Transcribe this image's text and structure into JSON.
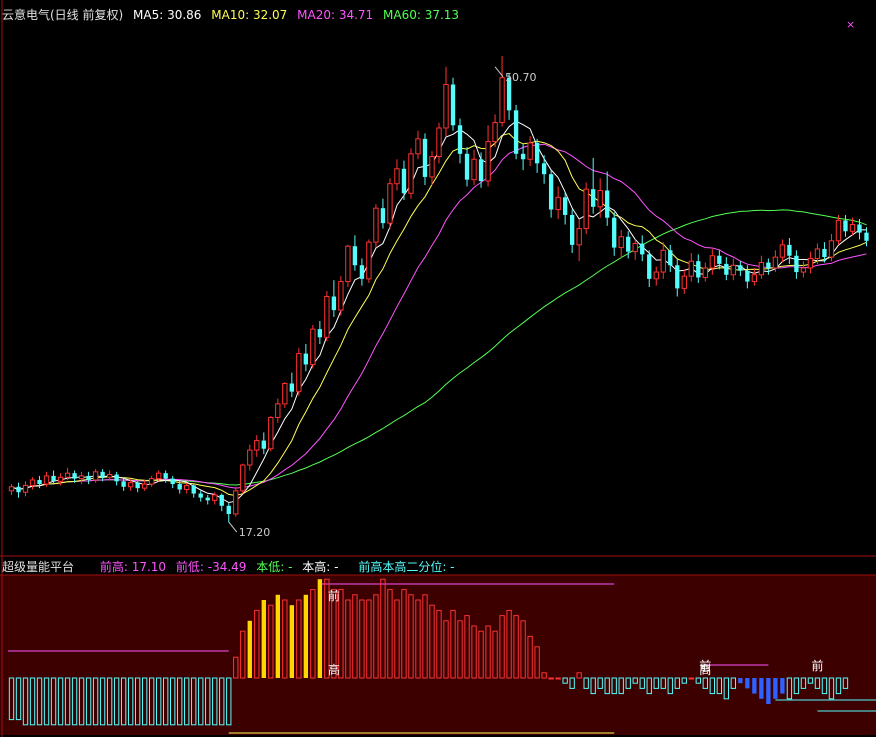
{
  "header": {
    "title": "云意电气(日线 前复权)",
    "ma5": "MA5: 30.86",
    "ma10": "MA10: 32.07",
    "ma20": "MA20: 34.71",
    "ma60": "MA60: 37.13",
    "close_mark": "×"
  },
  "colors": {
    "up": "#ff3232",
    "down": "#54fcfc",
    "ma5": "#ffffff",
    "ma10": "#ffff54",
    "ma20": "#ff54ff",
    "ma60": "#54ff54",
    "indicator_bg": "#3c0000",
    "yellow": "#ffd700",
    "blue": "#3060ff"
  },
  "indicator_header": {
    "name": "超级量能平台",
    "prev_high": "前高: 17.10",
    "prev_low": "前低: -34.49",
    "this_low": "本低: -",
    "this_high": "本高: -",
    "quantile": "前高本高二分位: -"
  },
  "chart_data": {
    "type": "candlestick",
    "price_range": [
      15,
      54
    ],
    "annotations": [
      {
        "text": "50.70",
        "index": 69,
        "value": 50.7
      },
      {
        "text": "17.20",
        "index": 31,
        "value": 17.2
      }
    ],
    "candles": [
      [
        19.5,
        19.8,
        20.0,
        19.2
      ],
      [
        19.8,
        19.4,
        20.1,
        19.0
      ],
      [
        19.4,
        19.9,
        20.2,
        19.1
      ],
      [
        19.9,
        20.3,
        20.5,
        19.6
      ],
      [
        20.3,
        20.0,
        20.6,
        19.7
      ],
      [
        20.0,
        20.6,
        20.9,
        19.8
      ],
      [
        20.6,
        20.2,
        21.0,
        20.0
      ],
      [
        20.2,
        20.5,
        20.8,
        19.9
      ],
      [
        20.5,
        20.8,
        21.2,
        20.3
      ],
      [
        20.8,
        20.4,
        21.0,
        20.1
      ],
      [
        20.4,
        20.6,
        20.9,
        20.0
      ],
      [
        20.6,
        20.3,
        20.9,
        20.0
      ],
      [
        20.3,
        20.9,
        21.1,
        20.1
      ],
      [
        20.9,
        20.5,
        21.1,
        20.2
      ],
      [
        20.5,
        20.7,
        21.0,
        20.3
      ],
      [
        20.7,
        20.2,
        20.9,
        19.9
      ],
      [
        20.2,
        19.8,
        20.4,
        19.5
      ],
      [
        19.8,
        20.1,
        20.4,
        19.5
      ],
      [
        20.1,
        19.7,
        20.2,
        19.4
      ],
      [
        19.7,
        20.0,
        20.3,
        19.5
      ],
      [
        20.0,
        20.4,
        20.6,
        19.8
      ],
      [
        20.4,
        20.8,
        21.0,
        20.2
      ],
      [
        20.8,
        20.4,
        21.0,
        20.1
      ],
      [
        20.4,
        20.0,
        20.6,
        19.7
      ],
      [
        20.0,
        19.6,
        20.2,
        19.3
      ],
      [
        19.6,
        19.9,
        20.1,
        19.3
      ],
      [
        19.9,
        19.3,
        20.0,
        19.0
      ],
      [
        19.3,
        19.0,
        19.5,
        18.7
      ],
      [
        19.0,
        18.8,
        19.2,
        18.5
      ],
      [
        18.8,
        19.2,
        19.4,
        18.5
      ],
      [
        19.2,
        18.4,
        19.3,
        18.0
      ],
      [
        18.4,
        17.8,
        18.6,
        17.2
      ],
      [
        17.8,
        19.5,
        19.8,
        17.6
      ],
      [
        19.5,
        21.4,
        21.5,
        19.3
      ],
      [
        21.4,
        22.5,
        22.9,
        21.0
      ],
      [
        22.5,
        23.2,
        23.6,
        22.0
      ],
      [
        23.2,
        22.6,
        23.8,
        22.2
      ],
      [
        22.6,
        24.9,
        25.0,
        22.4
      ],
      [
        24.9,
        25.9,
        26.3,
        24.5
      ],
      [
        25.9,
        27.4,
        27.5,
        25.6
      ],
      [
        27.4,
        26.8,
        28.2,
        26.4
      ],
      [
        26.8,
        29.6,
        30.0,
        26.5
      ],
      [
        29.6,
        28.8,
        30.3,
        28.3
      ],
      [
        28.8,
        31.4,
        31.7,
        28.5
      ],
      [
        31.4,
        30.8,
        32.0,
        30.3
      ],
      [
        30.8,
        33.8,
        34.2,
        30.5
      ],
      [
        33.8,
        32.8,
        35.0,
        32.3
      ],
      [
        32.8,
        34.9,
        35.3,
        32.4
      ],
      [
        34.9,
        37.5,
        37.6,
        34.5
      ],
      [
        37.5,
        36.1,
        38.3,
        35.7
      ],
      [
        36.1,
        35.1,
        36.6,
        34.6
      ],
      [
        35.1,
        37.8,
        38.0,
        34.8
      ],
      [
        37.8,
        40.3,
        40.6,
        37.4
      ],
      [
        40.3,
        39.2,
        41.0,
        38.8
      ],
      [
        39.2,
        42.1,
        42.5,
        38.8
      ],
      [
        42.1,
        43.2,
        43.9,
        41.6
      ],
      [
        43.2,
        41.4,
        43.8,
        40.9
      ],
      [
        41.4,
        44.3,
        44.7,
        41.0
      ],
      [
        44.3,
        45.4,
        46.0,
        43.9
      ],
      [
        45.4,
        42.6,
        45.8,
        42.0
      ],
      [
        42.6,
        44.1,
        44.5,
        42.0
      ],
      [
        44.1,
        46.2,
        46.6,
        43.6
      ],
      [
        46.2,
        49.4,
        50.7,
        45.6
      ],
      [
        49.4,
        46.4,
        49.9,
        46.0
      ],
      [
        46.4,
        44.3,
        46.9,
        43.6
      ],
      [
        44.3,
        42.4,
        44.8,
        41.9
      ],
      [
        42.4,
        43.9,
        44.6,
        42.0
      ],
      [
        43.9,
        42.3,
        44.4,
        41.8
      ],
      [
        42.3,
        45.2,
        46.4,
        41.9
      ],
      [
        45.2,
        46.6,
        47.2,
        44.8
      ],
      [
        46.6,
        49.9,
        51.5,
        46.3
      ],
      [
        49.9,
        47.5,
        50.2,
        46.8
      ],
      [
        47.5,
        44.3,
        47.9,
        43.9
      ],
      [
        44.3,
        43.9,
        45.0,
        43.1
      ],
      [
        43.9,
        45.1,
        45.6,
        43.4
      ],
      [
        45.1,
        43.6,
        45.4,
        42.9
      ],
      [
        43.6,
        42.8,
        44.2,
        42.1
      ],
      [
        42.8,
        40.2,
        43.1,
        39.6
      ],
      [
        40.2,
        41.1,
        41.9,
        39.5
      ],
      [
        41.1,
        39.8,
        41.5,
        39.1
      ],
      [
        39.8,
        37.6,
        40.2,
        37.0
      ],
      [
        37.6,
        38.8,
        39.5,
        36.4
      ],
      [
        38.8,
        41.7,
        42.2,
        38.4
      ],
      [
        41.7,
        40.4,
        44.0,
        39.9
      ],
      [
        40.4,
        41.6,
        42.5,
        39.6
      ],
      [
        41.6,
        39.6,
        43.0,
        39.0
      ],
      [
        39.6,
        37.4,
        40.0,
        36.8
      ],
      [
        37.4,
        38.2,
        38.7,
        36.6
      ],
      [
        38.2,
        37.1,
        38.6,
        36.6
      ],
      [
        37.1,
        37.7,
        38.0,
        36.5
      ],
      [
        37.7,
        36.9,
        38.3,
        36.4
      ],
      [
        36.9,
        35.1,
        37.2,
        34.5
      ],
      [
        35.1,
        35.6,
        36.0,
        34.6
      ],
      [
        35.6,
        37.2,
        37.8,
        35.1
      ],
      [
        37.2,
        36.1,
        37.6,
        35.6
      ],
      [
        36.1,
        34.4,
        36.6,
        33.8
      ],
      [
        34.4,
        35.3,
        35.8,
        34.0
      ],
      [
        35.3,
        36.4,
        37.0,
        34.9
      ],
      [
        36.4,
        35.2,
        36.9,
        34.8
      ],
      [
        35.2,
        35.9,
        36.3,
        34.9
      ],
      [
        35.9,
        36.8,
        37.3,
        35.4
      ],
      [
        36.8,
        36.2,
        37.2,
        35.8
      ],
      [
        36.2,
        35.4,
        36.7,
        35.0
      ],
      [
        35.4,
        36.1,
        36.6,
        35.0
      ],
      [
        36.1,
        35.7,
        36.4,
        35.3
      ],
      [
        35.7,
        34.9,
        36.1,
        34.4
      ],
      [
        34.9,
        35.4,
        35.9,
        34.6
      ],
      [
        35.4,
        36.3,
        36.8,
        35.1
      ],
      [
        36.3,
        35.9,
        36.6,
        35.4
      ],
      [
        35.9,
        36.7,
        37.2,
        35.6
      ],
      [
        36.7,
        37.6,
        38.0,
        36.3
      ],
      [
        37.6,
        36.8,
        38.1,
        36.2
      ],
      [
        36.8,
        35.6,
        37.2,
        35.1
      ],
      [
        35.6,
        35.9,
        36.4,
        35.2
      ],
      [
        35.9,
        36.6,
        37.1,
        35.5
      ],
      [
        36.6,
        37.3,
        37.7,
        36.2
      ],
      [
        37.3,
        36.7,
        37.8,
        36.3
      ],
      [
        36.7,
        37.9,
        38.4,
        36.4
      ],
      [
        37.9,
        39.4,
        39.8,
        37.6
      ],
      [
        39.4,
        38.6,
        39.8,
        38.2
      ],
      [
        38.6,
        39.1,
        39.6,
        38.3
      ],
      [
        39.1,
        38.5,
        39.5,
        38.0
      ],
      [
        38.5,
        37.9,
        38.9,
        37.5
      ]
    ],
    "ma5_line": "",
    "ma10_line": "",
    "ma20_line": "",
    "ma60_line": "",
    "indicator": {
      "baseline": 0,
      "bars": [
        -16,
        -16,
        -18,
        -18,
        -18,
        -18,
        -18,
        -18,
        -18,
        -18,
        -18,
        -18,
        -18,
        -18,
        -18,
        -18,
        -18,
        -18,
        -18,
        -18,
        -18,
        -18,
        -18,
        -18,
        -18,
        -18,
        -18,
        -18,
        -18,
        -18,
        -18,
        -18,
        8,
        18,
        22,
        26,
        30,
        28,
        32,
        30,
        28,
        30,
        32,
        34,
        38,
        38,
        34,
        34,
        30,
        32,
        30,
        30,
        32,
        38,
        34,
        30,
        34,
        32,
        30,
        32,
        28,
        26,
        22,
        26,
        22,
        24,
        20,
        18,
        20,
        18,
        24,
        26,
        24,
        22,
        16,
        12,
        2,
        0,
        0,
        -2,
        -4,
        2,
        -4,
        -6,
        -4,
        -6,
        -6,
        -6,
        -4,
        -2,
        -4,
        -6,
        -4,
        -4,
        -6,
        -4,
        -2,
        0,
        -2,
        -4,
        -6,
        -6,
        -8,
        -4,
        -2,
        -4,
        -6,
        -8,
        -10,
        -8,
        -6,
        -8,
        -6,
        -4,
        -2,
        -4,
        -6,
        -8,
        -6,
        -4
      ],
      "yellow_from": 34,
      "yellow_to": 44,
      "labels": [
        {
          "text": "前",
          "index": 46
        },
        {
          "text": "高",
          "index": 46
        },
        {
          "text": "前",
          "index": 99
        },
        {
          "text": "高",
          "index": 99
        },
        {
          "text": "前",
          "index": 115
        },
        {
          "text": "前",
          "index": 126
        }
      ]
    }
  }
}
